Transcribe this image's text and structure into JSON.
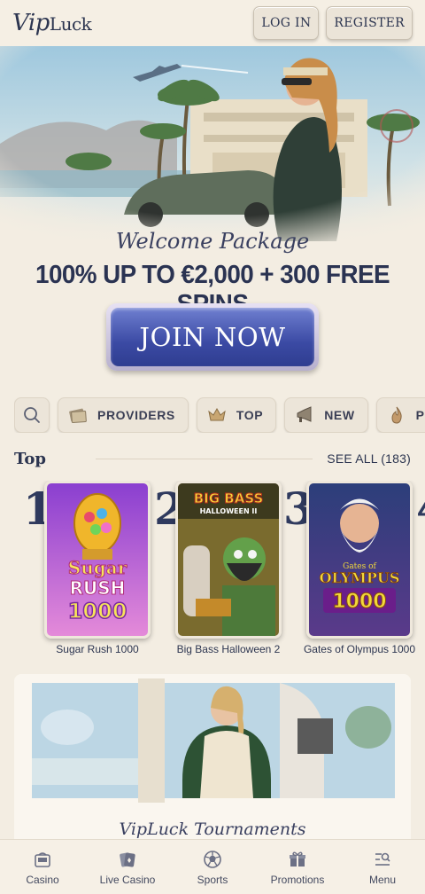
{
  "header": {
    "logo_main": "Vip",
    "logo_rest": "Luck",
    "login_label": "LOG IN",
    "register_label": "REGISTER"
  },
  "hero": {
    "welcome": "Welcome Package",
    "offer": "100% UP TO €2,000 + 300 FREE SPINS",
    "cta_label": "JOIN NOW"
  },
  "filters": [
    {
      "label": "",
      "icon": "search-icon"
    },
    {
      "label": "PROVIDERS",
      "icon": "providers-icon"
    },
    {
      "label": "TOP",
      "icon": "crown-icon"
    },
    {
      "label": "NEW",
      "icon": "megaphone-icon"
    },
    {
      "label": "PO",
      "icon": "flame-icon"
    }
  ],
  "top_section": {
    "title": "Top",
    "see_all": "SEE ALL (183)",
    "games": [
      {
        "rank": "1",
        "name": "Sugar Rush 1000",
        "thumb_line1": "Sugar",
        "thumb_line2": "RUSH",
        "thumb_line3": "1000"
      },
      {
        "rank": "2",
        "name": "Big Bass Halloween 2",
        "thumb_line1": "BIG BASS",
        "thumb_line2": "HALLOWEEN II",
        "thumb_line3": ""
      },
      {
        "rank": "3",
        "name": "Gates of Olympus 1000",
        "thumb_line1": "Gates of",
        "thumb_line2": "OLYMPUS",
        "thumb_line3": "1000"
      },
      {
        "rank": "4",
        "name": "",
        "thumb_line1": "",
        "thumb_line2": "",
        "thumb_line3": ""
      }
    ]
  },
  "tournaments": {
    "title": "VipLuck Tournaments"
  },
  "bottom_nav": [
    {
      "label": "Casino",
      "icon": "slot-machine-icon"
    },
    {
      "label": "Live Casino",
      "icon": "cards-icon"
    },
    {
      "label": "Sports",
      "icon": "ball-icon"
    },
    {
      "label": "Promotions",
      "icon": "gift-icon"
    },
    {
      "label": "Menu",
      "icon": "menu-search-icon"
    }
  ],
  "colors": {
    "background": "#f3ede2",
    "text": "#2c3550",
    "cta": "#3b4aa4"
  }
}
